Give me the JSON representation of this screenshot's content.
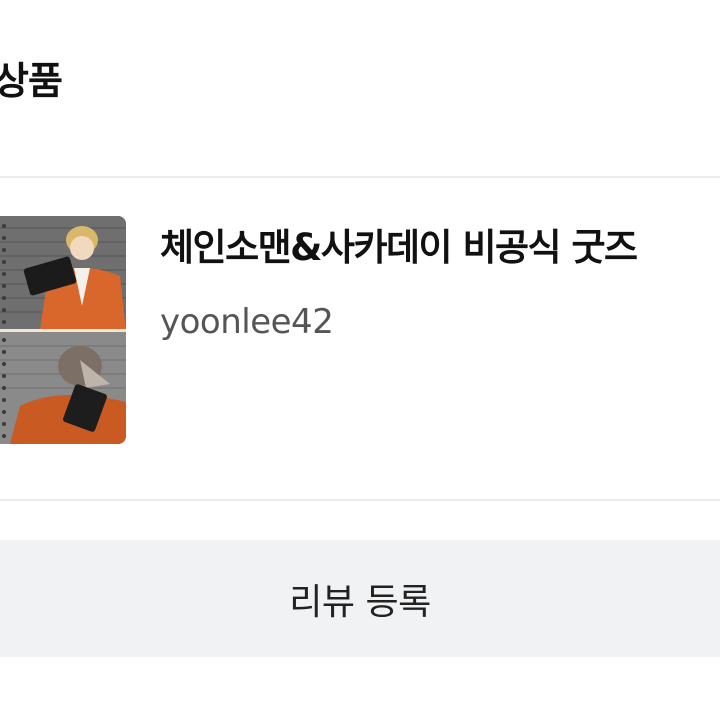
{
  "section": {
    "title": "상품"
  },
  "product": {
    "title": "체인소맨&사카데이 비공식 굿즈",
    "seller": "yoonlee42",
    "image_label": "product-thumbnail"
  },
  "actions": {
    "review_label": "리뷰 등록"
  }
}
